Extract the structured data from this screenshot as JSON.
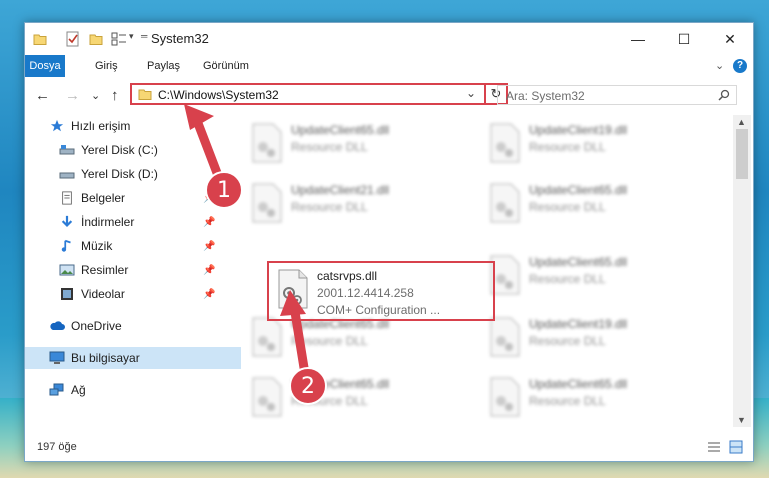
{
  "window": {
    "title": "System32",
    "minimize": "—",
    "maximize": "☐",
    "close": "✕"
  },
  "ribbon": {
    "tabs": [
      "Dosya",
      "Giriş",
      "Paylaş",
      "Görünüm"
    ],
    "active_tab": "Dosya",
    "expand": "⌄",
    "help": "?"
  },
  "nav": {
    "back": "←",
    "forward": "→",
    "recent": "⌄",
    "up": "↑",
    "address": "C:\\Windows\\System32",
    "address_dropdown": "⌄",
    "refresh": "↻",
    "search_placeholder": "Ara: System32"
  },
  "sidebar": {
    "items": [
      {
        "label": "Hızlı erişim",
        "icon": "star-icon",
        "pinned": false
      },
      {
        "label": "Yerel Disk (C:)",
        "icon": "drive-icon",
        "pinned": false
      },
      {
        "label": "Yerel Disk (D:)",
        "icon": "drive-icon",
        "pinned": false
      },
      {
        "label": "Belgeler",
        "icon": "documents-icon",
        "pinned": true
      },
      {
        "label": "İndirmeler",
        "icon": "downloads-icon",
        "pinned": true
      },
      {
        "label": "Müzik",
        "icon": "music-icon",
        "pinned": true
      },
      {
        "label": "Resimler",
        "icon": "pictures-icon",
        "pinned": true
      },
      {
        "label": "Videolar",
        "icon": "videos-icon",
        "pinned": true
      },
      {
        "label": "OneDrive",
        "icon": "cloud-icon",
        "pinned": false
      },
      {
        "label": "Bu bilgisayar",
        "icon": "computer-icon",
        "pinned": false
      },
      {
        "label": "Ağ",
        "icon": "network-icon",
        "pinned": false
      }
    ],
    "selected": "Bu bilgisayar",
    "pin_glyph": "📌"
  },
  "files": {
    "items": [
      {
        "name": "UpdateClient65.dll",
        "sub1": "Resource DLL",
        "sub2": ""
      },
      {
        "name": "UpdateClient19.dll",
        "sub1": "Resource DLL",
        "sub2": ""
      },
      {
        "name": "UpdateClient21.dll",
        "sub1": "Resource DLL",
        "sub2": ""
      },
      {
        "name": "UpdateClient65.dll",
        "sub1": "Resource DLL",
        "sub2": ""
      },
      {
        "name": "catsrvps.dll",
        "sub1": "2001.12.4414.258",
        "sub2": "COM+ Configuration ..."
      },
      {
        "name": "UpdateClient65.dll",
        "sub1": "Resource DLL",
        "sub2": ""
      },
      {
        "name": "UpdateClient65.dll",
        "sub1": "Resource DLL",
        "sub2": ""
      },
      {
        "name": "UpdateClient19.dll",
        "sub1": "Resource DLL",
        "sub2": ""
      },
      {
        "name": "UpdateClient65.dll",
        "sub1": "Resource DLL",
        "sub2": ""
      },
      {
        "name": "UpdateClient65.dll",
        "sub1": "Resource DLL",
        "sub2": ""
      }
    ]
  },
  "status": {
    "count": "197 öğe"
  },
  "callouts": {
    "one": "1",
    "two": "2"
  },
  "colors": {
    "accent": "#1979ca",
    "highlight": "#d8414c",
    "selected_bg": "#cce4f7"
  }
}
